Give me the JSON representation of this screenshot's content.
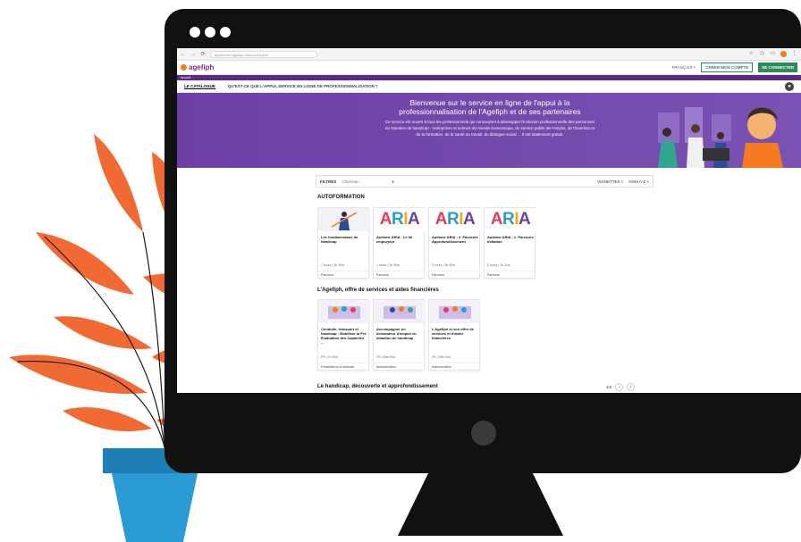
{
  "browser": {
    "url": "apprendre.agefiph.fr/learn/explore"
  },
  "app": {
    "logo": "agefiph",
    "lang": "FRANÇAIS ˅",
    "create_account": "CRÉER MON COMPTE",
    "login": "SE CONNECTER"
  },
  "breadcrumb": "Accueil",
  "tabs": [
    "LE CATALOGUE",
    "QU'EST-CE QUE L'APPUI, SERVICE EN LIGNE DE PROFESSIONNALISATION ?"
  ],
  "hero": {
    "title": "Bienvenue sur le service en ligne de l'appui à la professionnalisation de l'Agefiph et de ses partenaires",
    "body": "Ce service est ouvert à tous les professionnels qui concourent à développer l'inclusion professionnelle des personnes en situation de handicap : entreprises et acteurs du monde économique, du service public de l'emploi, de l'insertion et de la formation, de la santé au travail, du dialogue social ... Il est totalement gratuit."
  },
  "search": {
    "filters": "FILTRES",
    "placeholder": "Chercher...",
    "view": "VIGNETTES ˅",
    "sort": "NOM A-Z ˅"
  },
  "sections": [
    {
      "title": "AUTOFORMATION",
      "cards": [
        {
          "title": "Les fondamentaux du handicap",
          "meta": "7 cours | 1h 30m",
          "type": "Parcours",
          "thumb": "illustration"
        },
        {
          "title": "Autisme ARIA : Le kit employeur",
          "meta": "1 cours | 1h 40m",
          "type": "Parcours",
          "thumb": "ARIA"
        },
        {
          "title": "Autisme ARIA : 2. Parcours Approfondissement",
          "meta": "3 cours | 2h 40m",
          "type": "Parcours",
          "thumb": "ARIA"
        },
        {
          "title": "Autisme ARIA : 1. Parcours Initiation",
          "meta": "2 cours | 1h 11m",
          "type": "Parcours",
          "thumb": "ARIA"
        }
      ]
    },
    {
      "title": "L'Agefiph, offre de services et aides financières",
      "cards": [
        {
          "title": "Conduite, transport et handicap : Mobiliser la Pré Évaluation des Capacités ...",
          "meta": "FR | 1h 00m",
          "type": "Présentiel ou à distance",
          "thumb": "illustration"
        },
        {
          "title": "Accompagner un demandeur d'emploi en situation de handicap",
          "meta": "FR | 45m 00s",
          "type": "Autoformation",
          "thumb": "illustration"
        },
        {
          "title": "L'Agefiph et son offre de services et d'aides financières",
          "meta": "FR | 30m 00s",
          "type": "Autoformation",
          "thumb": "illustration"
        }
      ]
    },
    {
      "title": "Le handicap, découverte et approfondissement",
      "cards": []
    }
  ],
  "pager": {
    "text": "1/2",
    "prev": "‹",
    "next": "›"
  },
  "colors": {
    "brand_purple": "#6d3fa5",
    "brand_orange": "#f47b20",
    "brand_green": "#2d8a5a",
    "plant_orange": "#f26a33",
    "pot_blue": "#1e7fb5"
  }
}
